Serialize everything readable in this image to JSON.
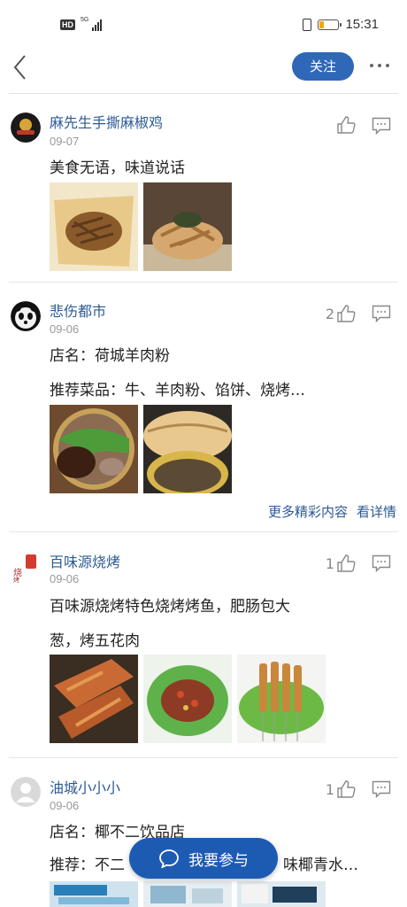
{
  "status_bar": {
    "hd": "HD",
    "net": "5G",
    "time": "15:31",
    "battery_fraction": 0.25
  },
  "nav": {
    "follow_label": "关注",
    "back_icon": "back-chevron-icon",
    "more_icon": "more-dots-icon"
  },
  "posts": [
    {
      "name": "麻先生手撕麻椒鸡",
      "date": "09-07",
      "likes": "",
      "text": [
        "美食无语，味道说话"
      ]
    },
    {
      "name": "悲伤都市",
      "date": "09-06",
      "likes": "2",
      "text": [
        "店名：荷城羊肉粉",
        "推荐菜品：牛、羊肉粉、馅饼、烧烤…"
      ],
      "more": {
        "text": "更多精彩内容",
        "link": "看详情"
      }
    },
    {
      "name": "百味源烧烤",
      "date": "09-06",
      "likes": "1",
      "text": [
        "百味源烧烤特色烧烤烤鱼，肥肠包大",
        "葱，烤五花肉"
      ]
    },
    {
      "name": "油城小小小",
      "date": "09-06",
      "likes": "1",
      "text": [
        "店名：椰不二饮品店",
        "推荐：不二",
        "味椰青水…"
      ]
    }
  ],
  "join_button": {
    "label": "我要参与"
  },
  "colors": {
    "accent": "#2e68b6",
    "name": "#2b5a93",
    "join": "#1d5bb3"
  }
}
